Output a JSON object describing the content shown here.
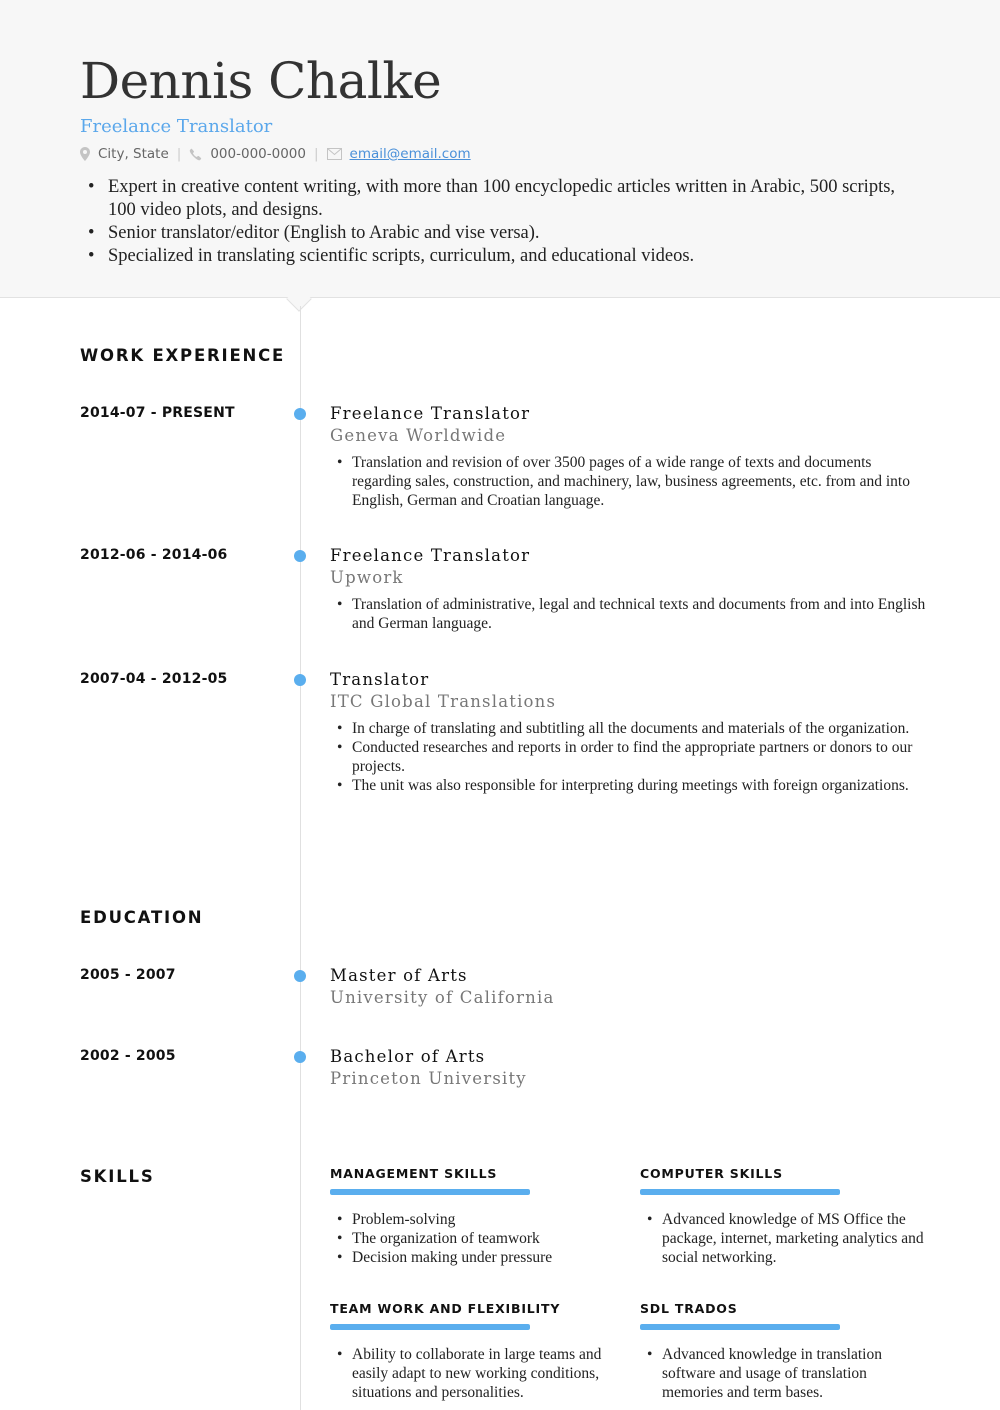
{
  "header": {
    "name": "Dennis Chalke",
    "title": "Freelance Translator",
    "contact": {
      "location_icon": "map-pin-icon",
      "location": "City, State",
      "phone_icon": "phone-icon",
      "phone": "000-000-0000",
      "email_icon": "envelope-icon",
      "email": "email@email.com",
      "separator": "|"
    },
    "summary": [
      "Expert in creative content writing, with more than 100 encyclopedic articles written in Arabic, 500 scripts, 100 video plots, and designs.",
      "Senior translator/editor (English to Arabic and vise versa).",
      "Specialized in translating scientific scripts, curriculum, and educational videos."
    ]
  },
  "work": {
    "title": "WORK EXPERIENCE",
    "entries": [
      {
        "date": "2014-07 - PRESENT",
        "role": "Freelance Translator",
        "org": "Geneva Worldwide",
        "bullets": [
          "Translation and revision of over 3500 pages of a wide range of texts and documents regarding sales, construction, and machinery, law, business agreements, etc. from and into English, German and Croatian language."
        ]
      },
      {
        "date": "2012-06 - 2014-06",
        "role": "Freelance Translator",
        "org": "Upwork",
        "bullets": [
          "Translation of administrative, legal and technical texts and documents from and into English and German language."
        ]
      },
      {
        "date": "2007-04 - 2012-05",
        "role": "Translator",
        "org": "ITC Global Translations",
        "bullets": [
          "In charge of translating and subtitling all the documents and materials of the organization.",
          "Conducted researches and reports in order to find the appropriate partners or donors to our projects.",
          "The unit was also responsible for interpreting during meetings with foreign organizations."
        ]
      }
    ]
  },
  "education": {
    "title": "EDUCATION",
    "entries": [
      {
        "date": "2005 - 2007",
        "degree": "Master of Arts",
        "school": "University of California"
      },
      {
        "date": "2002 - 2005",
        "degree": "Bachelor of Arts",
        "school": "Princeton University"
      }
    ]
  },
  "skills": {
    "title": "SKILLS",
    "accent_color": "#5aaeee",
    "items": [
      {
        "name": "MANAGEMENT SKILLS",
        "level_percent": 100,
        "bullets": [
          "Problem-solving",
          "The organization of teamwork",
          "Decision making under pressure"
        ]
      },
      {
        "name": "COMPUTER SKILLS",
        "level_percent": 100,
        "bullets": [
          "Advanced knowledge of MS Office the package, internet, marketing analytics and social networking."
        ]
      },
      {
        "name": "TEAM WORK AND FLEXIBILITY",
        "level_percent": 100,
        "bullets": [
          "Ability to collaborate in large teams and easily adapt to new working conditions, situations and personalities."
        ]
      },
      {
        "name": "SDL TRADOS",
        "level_percent": 100,
        "bullets": [
          "Advanced knowledge in translation software and usage of translation memories and term bases."
        ]
      }
    ]
  }
}
